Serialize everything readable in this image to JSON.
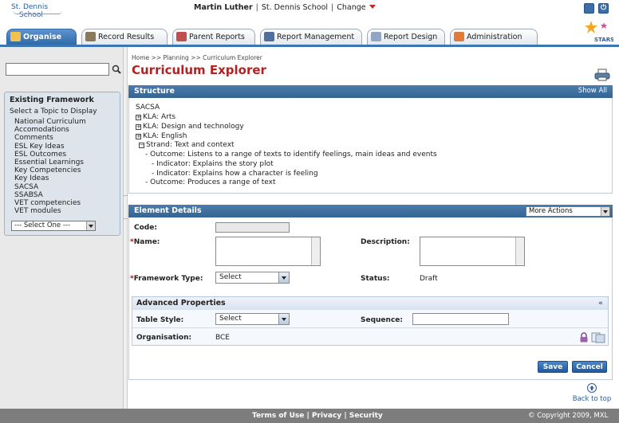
{
  "logo": {
    "line1": "St. Dennis",
    "line2": "School"
  },
  "user": {
    "name": "Martin Luther",
    "school": "St. Dennis School",
    "change": "Change"
  },
  "tabs": [
    {
      "label": "Organise"
    },
    {
      "label": "Record Results"
    },
    {
      "label": "Parent Reports"
    },
    {
      "label": "Report Management"
    },
    {
      "label": "Report Design"
    },
    {
      "label": "Administration"
    }
  ],
  "stars_logo": "STARS",
  "sidebar": {
    "search": {
      "value": "",
      "placeholder": ""
    },
    "framework": {
      "title": "Existing Framework",
      "subtitle": "Select a Topic to Display",
      "items": [
        "National Curriculum",
        "Accomodations",
        "Comments",
        "ESL Key Ideas",
        "ESL Outcomes",
        "Essential Learnings",
        "Key Competencies",
        "Key Ideas",
        "SACSA",
        "SSABSA",
        "VET competencies",
        "VET modules"
      ],
      "select": "--- Select One ---"
    }
  },
  "breadcrumb": "Home >> Planning >> Curriculum Explorer",
  "page_title": "Curriculum Explorer",
  "structure": {
    "title": "Structure",
    "show_all": "Show All",
    "root": "SACSA",
    "kla1": "KLA: Arts",
    "kla2": "KLA: Design and technology",
    "kla3": "KLA: English",
    "strand": "Strand: Text and context",
    "outcome1": "- Outcome: Listens to a range of texts to identify feelings, main ideas and events",
    "indicator1": "- Indicator: Explains the story plot",
    "indicator2": "- Indicator: Explains how a character is feeling",
    "outcome2": "- Outcome: Produces a range of text"
  },
  "element": {
    "title": "Element Details",
    "more_actions": "More Actions",
    "code_label": "Code:",
    "code_value": "",
    "name_label": "Name:",
    "name_value": "",
    "description_label": "Description:",
    "description_value": "",
    "framework_type_label": "Framework Type:",
    "framework_type_value": "Select",
    "status_label": "Status:",
    "status_value": "Draft"
  },
  "advanced": {
    "title": "Advanced Properties",
    "table_style_label": "Table Style:",
    "table_style_value": "Select",
    "sequence_label": "Sequence:",
    "sequence_value": "",
    "organisation_label": "Organisation:",
    "organisation_value": "BCE"
  },
  "buttons": {
    "save": "Save",
    "cancel": "Cancel"
  },
  "back_to_top": "Back to top",
  "footer": {
    "terms": "Terms of Use",
    "privacy": "Privacy",
    "security": "Security",
    "copyright": "© Copyright 2009, MXL"
  },
  "colors": {
    "accent": "#336493",
    "title_red": "#b22222",
    "tab_active": "#2e6aaa"
  }
}
